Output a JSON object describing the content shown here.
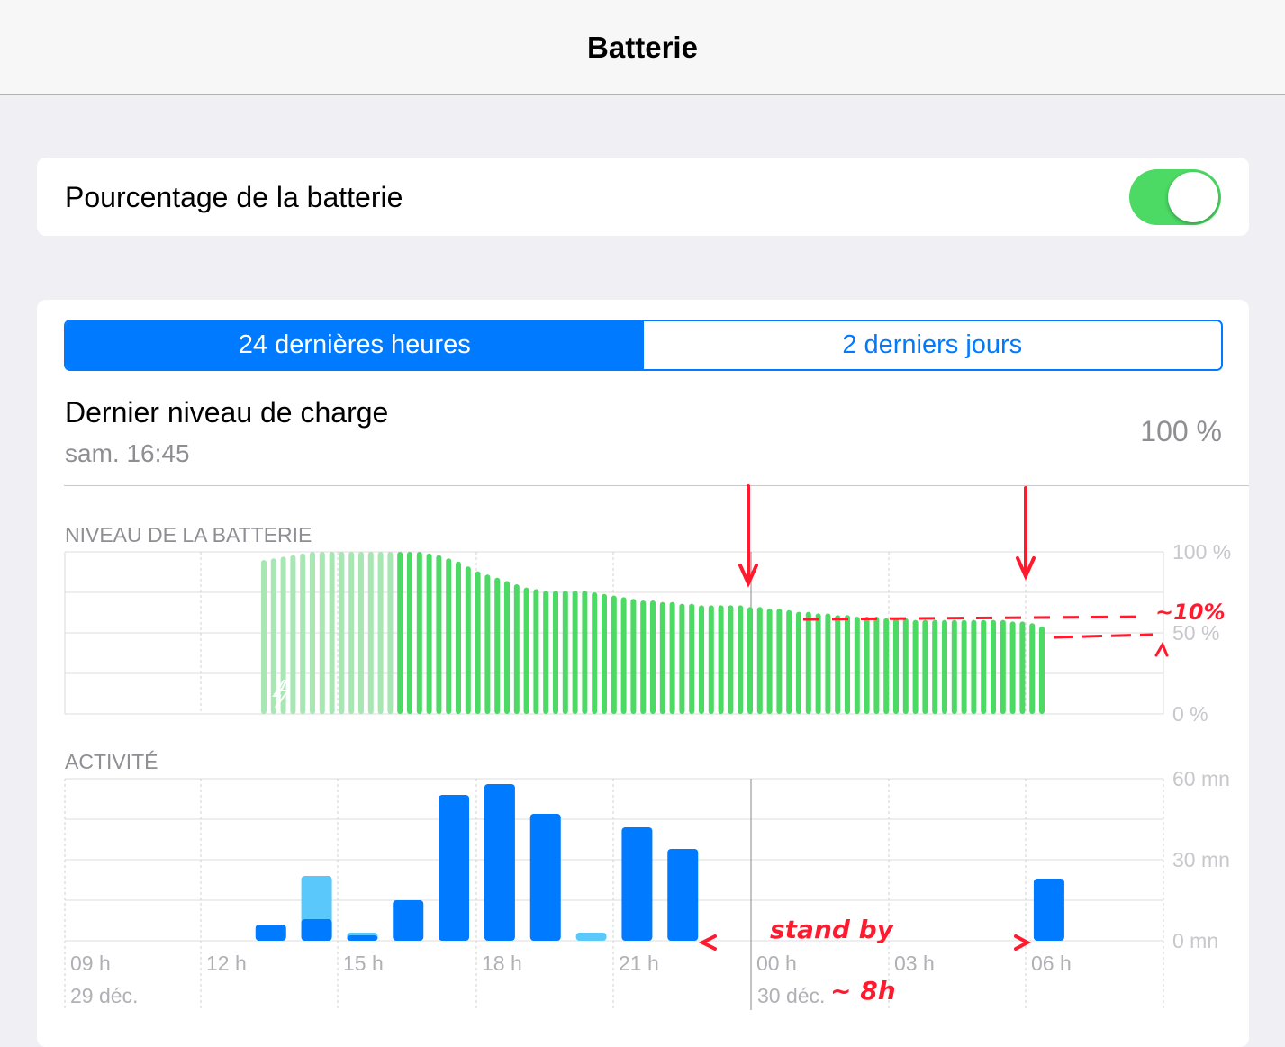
{
  "nav": {
    "title": "Batterie"
  },
  "toggle": {
    "label": "Pourcentage de la batterie",
    "on": true
  },
  "segments": [
    {
      "label": "24 dernières heures",
      "active": true
    },
    {
      "label": "2 derniers jours",
      "active": false
    }
  ],
  "last_charge": {
    "label": "Dernier niveau de charge",
    "time": "sam. 16:45",
    "value": "100 %"
  },
  "battery_section": {
    "label": "NIVEAU DE LA BATTERIE"
  },
  "activity_section": {
    "label": "ACTIVITÉ"
  },
  "annotations": {
    "standby": "stand by",
    "duration": "~ 8h",
    "pct": "~10%"
  },
  "colors": {
    "battery_green": "#4cd964",
    "charging_stripe": "#a8e6b4",
    "activity_blue": "#007aff",
    "activity_lightblue": "#5ac8fa",
    "annotation_red": "#ff1a2e"
  },
  "chart_data": [
    {
      "type": "bar",
      "title": "NIVEAU DE LA BATTERIE",
      "ylim": [
        0,
        100
      ],
      "y_tick_labels": [
        "100 %",
        "50 %",
        "0 %"
      ],
      "charging_bars": 14,
      "values": [
        95,
        96,
        97,
        98,
        99,
        100,
        100,
        100,
        100,
        100,
        100,
        100,
        100,
        100,
        100,
        100,
        100,
        99,
        98,
        96,
        94,
        91,
        88,
        86,
        84,
        82,
        80,
        78,
        77,
        76,
        76,
        76,
        76,
        76,
        75,
        74,
        73,
        72,
        71,
        70,
        70,
        69,
        69,
        68,
        68,
        67,
        67,
        67,
        67,
        67,
        66,
        66,
        65,
        65,
        64,
        63,
        63,
        62,
        62,
        61,
        61,
        60,
        60,
        60,
        59,
        59,
        59,
        58,
        58,
        58,
        58,
        58,
        58,
        58,
        58,
        58,
        58,
        57,
        57,
        56,
        54
      ]
    },
    {
      "type": "bar",
      "title": "ACTIVITÉ",
      "ylim": [
        0,
        60
      ],
      "y_tick_labels": [
        "60 mn",
        "30 mn",
        "0 mn"
      ],
      "x_tick_labels": [
        "09 h",
        "12 h",
        "15 h",
        "18 h",
        "21 h",
        "00 h",
        "03 h",
        "06 h"
      ],
      "date_labels": [
        "29 déc.",
        "30 déc."
      ],
      "series": [
        {
          "name": "screen_on",
          "values": [
            0,
            0,
            0,
            0,
            6,
            8,
            2,
            15,
            54,
            58,
            47,
            0,
            42,
            34,
            0,
            0,
            0,
            0,
            0,
            0,
            0,
            23
          ]
        },
        {
          "name": "screen_off",
          "values": [
            0,
            0,
            0,
            0,
            6,
            24,
            3,
            15,
            54,
            58,
            47,
            3,
            42,
            34,
            0,
            0,
            0,
            0,
            0,
            0,
            0,
            23
          ]
        }
      ]
    }
  ]
}
